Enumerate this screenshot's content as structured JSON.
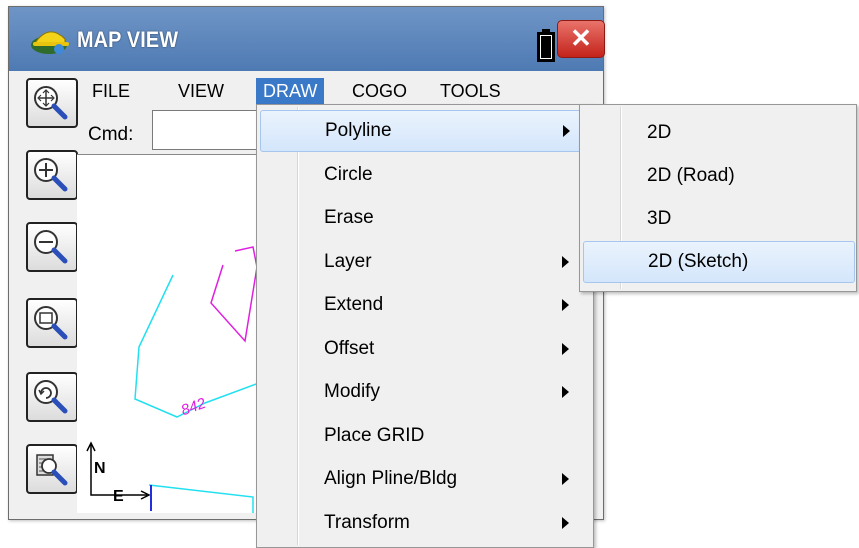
{
  "window": {
    "title": "MAP VIEW",
    "close_symbol": "✕",
    "icons": {
      "app": "hardhat-logo-icon",
      "battery": "battery-icon",
      "close": "close-icon"
    }
  },
  "toolbar": {
    "tools": [
      {
        "name": "zoom-extents-icon"
      },
      {
        "name": "zoom-in-icon"
      },
      {
        "name": "zoom-out-icon"
      },
      {
        "name": "zoom-window-icon"
      },
      {
        "name": "zoom-previous-icon"
      },
      {
        "name": "zoom-settings-icon"
      }
    ]
  },
  "menubar": {
    "items": [
      "FILE",
      "VIEW",
      "DRAW",
      "COGO",
      "TOOLS"
    ],
    "active": "DRAW"
  },
  "command": {
    "label": "Cmd:",
    "value": ""
  },
  "map": {
    "north_label": "N",
    "east_label": "E",
    "point_label": "842",
    "colors": {
      "cyan": "#22e0f0",
      "magenta": "#e020e0",
      "blue": "#2030e0",
      "red": "#e02020",
      "green": "#20c020",
      "black": "#000000"
    }
  },
  "draw_menu": {
    "items": [
      {
        "label": "Polyline",
        "submenu": true,
        "highlighted": true
      },
      {
        "label": "Circle",
        "submenu": false
      },
      {
        "label": "Erase",
        "submenu": false
      },
      {
        "label": "Layer",
        "submenu": true
      },
      {
        "label": "Extend",
        "submenu": true
      },
      {
        "label": "Offset",
        "submenu": true
      },
      {
        "label": "Modify",
        "submenu": true
      },
      {
        "label": "Place GRID",
        "submenu": false
      },
      {
        "label": "Align Pline/Bldg",
        "submenu": true
      },
      {
        "label": "Transform",
        "submenu": true
      }
    ]
  },
  "polyline_submenu": {
    "items": [
      {
        "label": "2D"
      },
      {
        "label": "2D (Road)"
      },
      {
        "label": "3D"
      },
      {
        "label": "2D (Sketch)",
        "highlighted": true
      }
    ]
  }
}
